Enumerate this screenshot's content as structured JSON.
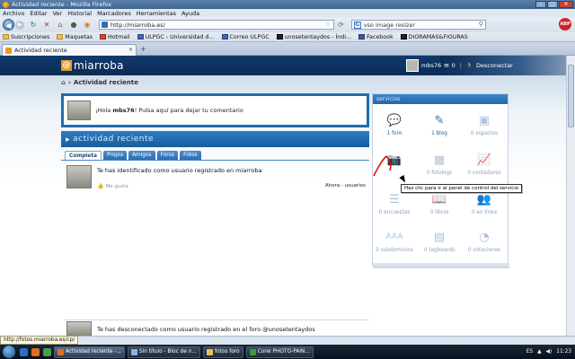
{
  "window": {
    "title": "Actividad reciente - Mozilla Firefox",
    "controls": {
      "minimize": "–",
      "maximize": "□",
      "close": "✕"
    }
  },
  "menu": [
    "Archivo",
    "Editar",
    "Ver",
    "Historial",
    "Marcadores",
    "Herramientas",
    "Ayuda"
  ],
  "nav": {
    "url": "http://miarroba.es/",
    "search_value": "vso image resizer",
    "search_engine_glyph": "G",
    "adblock_label": "ABP"
  },
  "bookmarks": [
    "Suscripciones",
    "Maquetas",
    "Hotmail",
    "ULPGC - Universidad d...",
    "Correo ULPGC",
    "unosetentaydos - Índi...",
    "Facebook",
    "DIORAMAS&FIGURAS"
  ],
  "tab": {
    "label": "Actividad reciente",
    "new_tab": "+"
  },
  "site": {
    "logo_at": "@",
    "logo_text": "miarroba",
    "username": "mbs76",
    "messages_count": "0",
    "logout": "Desconectar"
  },
  "breadcrumb": "Actividad reciente",
  "comment_box": {
    "greeting_prefix": "¡Hola",
    "username": "mbs76",
    "greeting_suffix": "! Pulsa aquí para dejar tu comentario"
  },
  "activity": {
    "title": "actividad reciente",
    "tabs": [
      "Completa",
      "Propia",
      "Amigos",
      "Foros",
      "Fotos"
    ],
    "active_tab": "Completa",
    "items": [
      {
        "message": "Te has identificado como usuario registrado en miarroba",
        "like": "Me gusta",
        "meta": "Ahora - usuarios"
      },
      {
        "message": "Te has desconectado como usuario registrado en el foro @unosetentaydos"
      }
    ]
  },
  "services": {
    "title": "servicios",
    "items": [
      {
        "label": "1 foro",
        "active": true,
        "icon": "speech-bubble-icon"
      },
      {
        "label": "1 blog",
        "active": true,
        "icon": "pencil-icon"
      },
      {
        "label": "0 espacios",
        "active": false,
        "icon": "folder-icon"
      },
      {
        "label": "",
        "active": true,
        "icon": "camera-icon"
      },
      {
        "label": "0 fotologs",
        "active": false,
        "icon": "photolog-icon"
      },
      {
        "label": "0 contadores",
        "active": false,
        "icon": "chart-line-icon"
      },
      {
        "label": "0 encuestas",
        "active": false,
        "icon": "poll-icon"
      },
      {
        "label": "0 libros",
        "active": false,
        "icon": "book-icon"
      },
      {
        "label": "0 en línea",
        "active": false,
        "icon": "people-icon"
      },
      {
        "label": "0 subdominios",
        "active": false,
        "icon": "domain-icon"
      },
      {
        "label": "0 tagboards",
        "active": false,
        "icon": "tagboard-icon"
      },
      {
        "label": "0 votaciones",
        "active": false,
        "icon": "pie-icon"
      }
    ],
    "tooltip": "Haz clic para ir al panel de control del servicio"
  },
  "status": {
    "url": "http://fotos.miarroba.es/cp/"
  },
  "taskbar": {
    "tasks": [
      "Actividad reciente -...",
      "Sin título - Bloc de n...",
      "fotos foro",
      "Corel PHOTO-PAIN..."
    ],
    "active_task": 0,
    "tray": {
      "language": "ES",
      "time": "11:23"
    }
  },
  "colors": {
    "header": "#0a2b54",
    "accent": "#1f6db0",
    "logo": "#e69b2a"
  }
}
